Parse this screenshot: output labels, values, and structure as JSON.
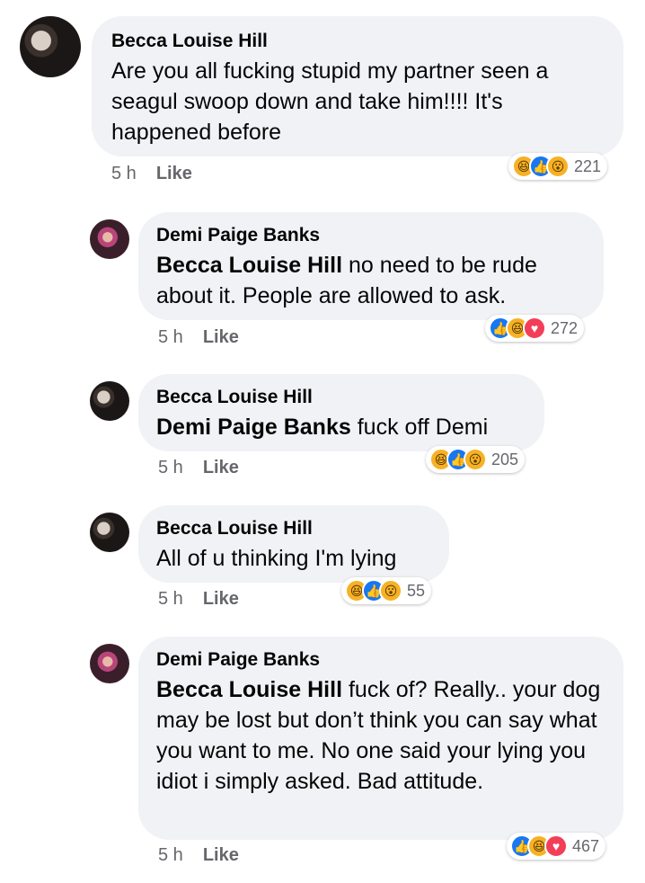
{
  "comments": [
    {
      "author": "Becca Louise Hill",
      "mention": "",
      "text": "Are you all fucking stupid my partner seen a seagul swoop down and take him!!!! It's happened before",
      "time": "5 h",
      "like_label": "Like",
      "reactions": [
        "haha",
        "like",
        "wow"
      ],
      "reaction_count": "221"
    },
    {
      "author": "Demi Paige Banks",
      "mention": "Becca Louise Hill",
      "text": "no need to be rude about it. People are allowed to ask.",
      "time": "5 h",
      "like_label": "Like",
      "reactions": [
        "like",
        "haha",
        "love"
      ],
      "reaction_count": "272"
    },
    {
      "author": "Becca Louise Hill",
      "mention": "Demi Paige Banks",
      "text": "fuck off Demi",
      "time": "5 h",
      "like_label": "Like",
      "reactions": [
        "haha",
        "like",
        "wow"
      ],
      "reaction_count": "205"
    },
    {
      "author": "Becca Louise Hill",
      "mention": "",
      "text": "All of u thinking I'm lying",
      "time": "5 h",
      "like_label": "Like",
      "reactions": [
        "haha",
        "like",
        "wow"
      ],
      "reaction_count": "55"
    },
    {
      "author": "Demi Paige Banks",
      "mention": "Becca Louise Hill",
      "text": "fuck of? Really.. your dog may be lost but don’t think you can say what you want to me. No one said your lying you idiot i simply asked. Bad attitude.",
      "time": "5 h",
      "like_label": "Like",
      "reactions": [
        "like",
        "haha",
        "love"
      ],
      "reaction_count": "467"
    }
  ],
  "reaction_icons": {
    "like": "thumbs-up-icon",
    "haha": "laughing-face-icon",
    "wow": "surprised-face-icon",
    "love": "heart-icon"
  },
  "colors": {
    "bubble": "#f0f2f5",
    "like": "#1877f2",
    "haha": "#f7b125",
    "love": "#f33e58",
    "meta": "#65676b"
  }
}
